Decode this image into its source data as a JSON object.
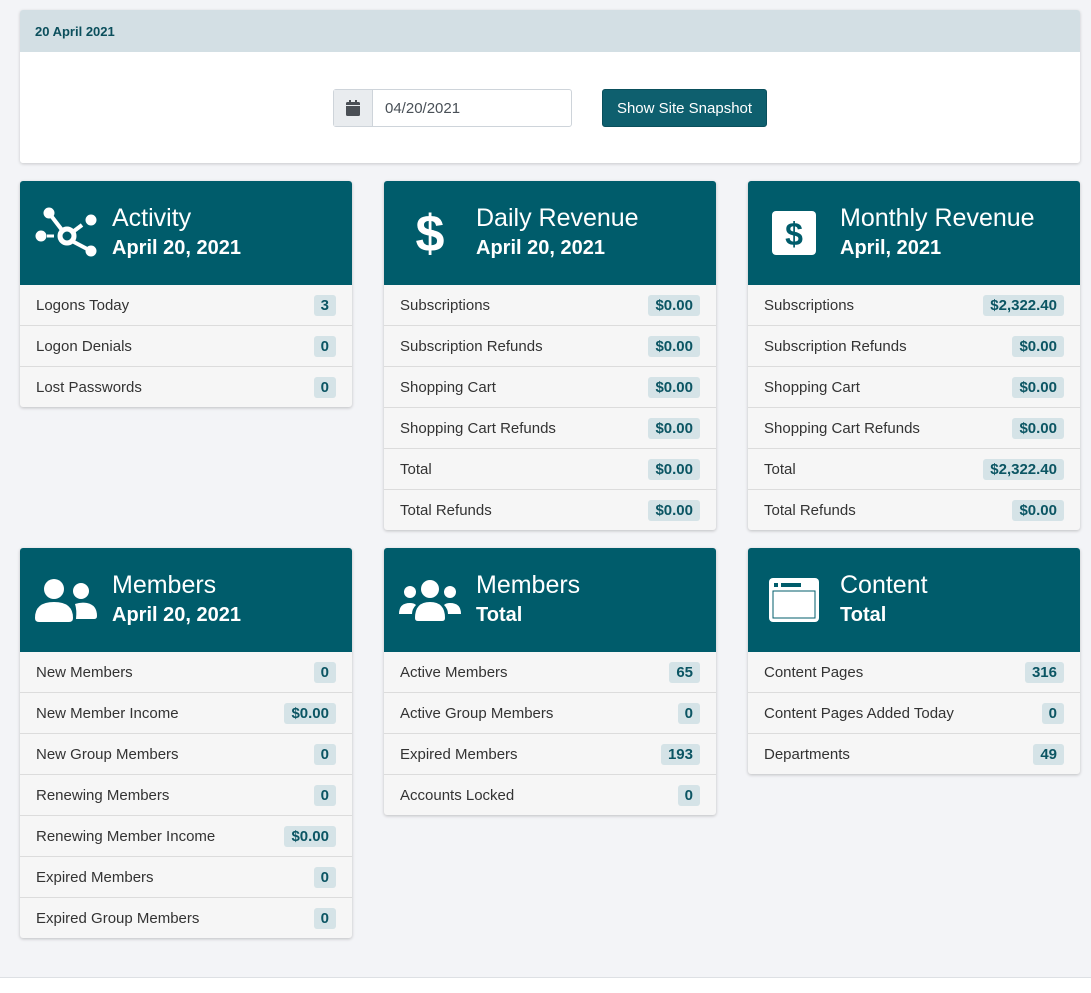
{
  "header": {
    "title": "20 April 2021"
  },
  "snapshot": {
    "date_value": "04/20/2021",
    "button_label": "Show Site Snapshot",
    "icon": "calendar-icon"
  },
  "colors": {
    "accent": "#005c6b",
    "header_bg": "#d3dfe4",
    "badge_bg": "#d5e3e7"
  },
  "cards": [
    {
      "icon": "network-icon",
      "title": "Activity",
      "subtitle": "April 20, 2021",
      "rows": [
        {
          "label": "Logons Today",
          "value": "3"
        },
        {
          "label": "Logon Denials",
          "value": "0"
        },
        {
          "label": "Lost Passwords",
          "value": "0"
        }
      ]
    },
    {
      "icon": "dollar-icon",
      "title": "Daily Revenue",
      "subtitle": "April 20, 2021",
      "rows": [
        {
          "label": "Subscriptions",
          "value": "$0.00"
        },
        {
          "label": "Subscription Refunds",
          "value": "$0.00"
        },
        {
          "label": "Shopping Cart",
          "value": "$0.00"
        },
        {
          "label": "Shopping Cart Refunds",
          "value": "$0.00"
        },
        {
          "label": "Total",
          "value": "$0.00"
        },
        {
          "label": "Total Refunds",
          "value": "$0.00"
        }
      ]
    },
    {
      "icon": "money-bill-icon",
      "title": "Monthly Revenue",
      "subtitle": "April, 2021",
      "rows": [
        {
          "label": "Subscriptions",
          "value": "$2,322.40"
        },
        {
          "label": "Subscription Refunds",
          "value": "$0.00"
        },
        {
          "label": "Shopping Cart",
          "value": "$0.00"
        },
        {
          "label": "Shopping Cart Refunds",
          "value": "$0.00"
        },
        {
          "label": "Total",
          "value": "$2,322.40"
        },
        {
          "label": "Total Refunds",
          "value": "$0.00"
        }
      ]
    },
    {
      "icon": "user-friends-icon",
      "title": "Members",
      "subtitle": "April 20, 2021",
      "rows": [
        {
          "label": "New Members",
          "value": "0"
        },
        {
          "label": "New Member Income",
          "value": "$0.00"
        },
        {
          "label": "New Group Members",
          "value": "0"
        },
        {
          "label": "Renewing Members",
          "value": "0"
        },
        {
          "label": "Renewing Member Income",
          "value": "$0.00"
        },
        {
          "label": "Expired Members",
          "value": "0"
        },
        {
          "label": "Expired Group Members",
          "value": "0"
        }
      ]
    },
    {
      "icon": "users-icon",
      "title": "Members",
      "subtitle": "Total",
      "rows": [
        {
          "label": "Active Members",
          "value": "65"
        },
        {
          "label": "Active Group Members",
          "value": "0"
        },
        {
          "label": "Expired Members",
          "value": "193"
        },
        {
          "label": "Accounts Locked",
          "value": "0"
        }
      ]
    },
    {
      "icon": "window-icon",
      "title": "Content",
      "subtitle": "Total",
      "rows": [
        {
          "label": "Content Pages",
          "value": "316"
        },
        {
          "label": "Content Pages Added Today",
          "value": "0"
        },
        {
          "label": "Departments",
          "value": "49"
        }
      ]
    }
  ]
}
